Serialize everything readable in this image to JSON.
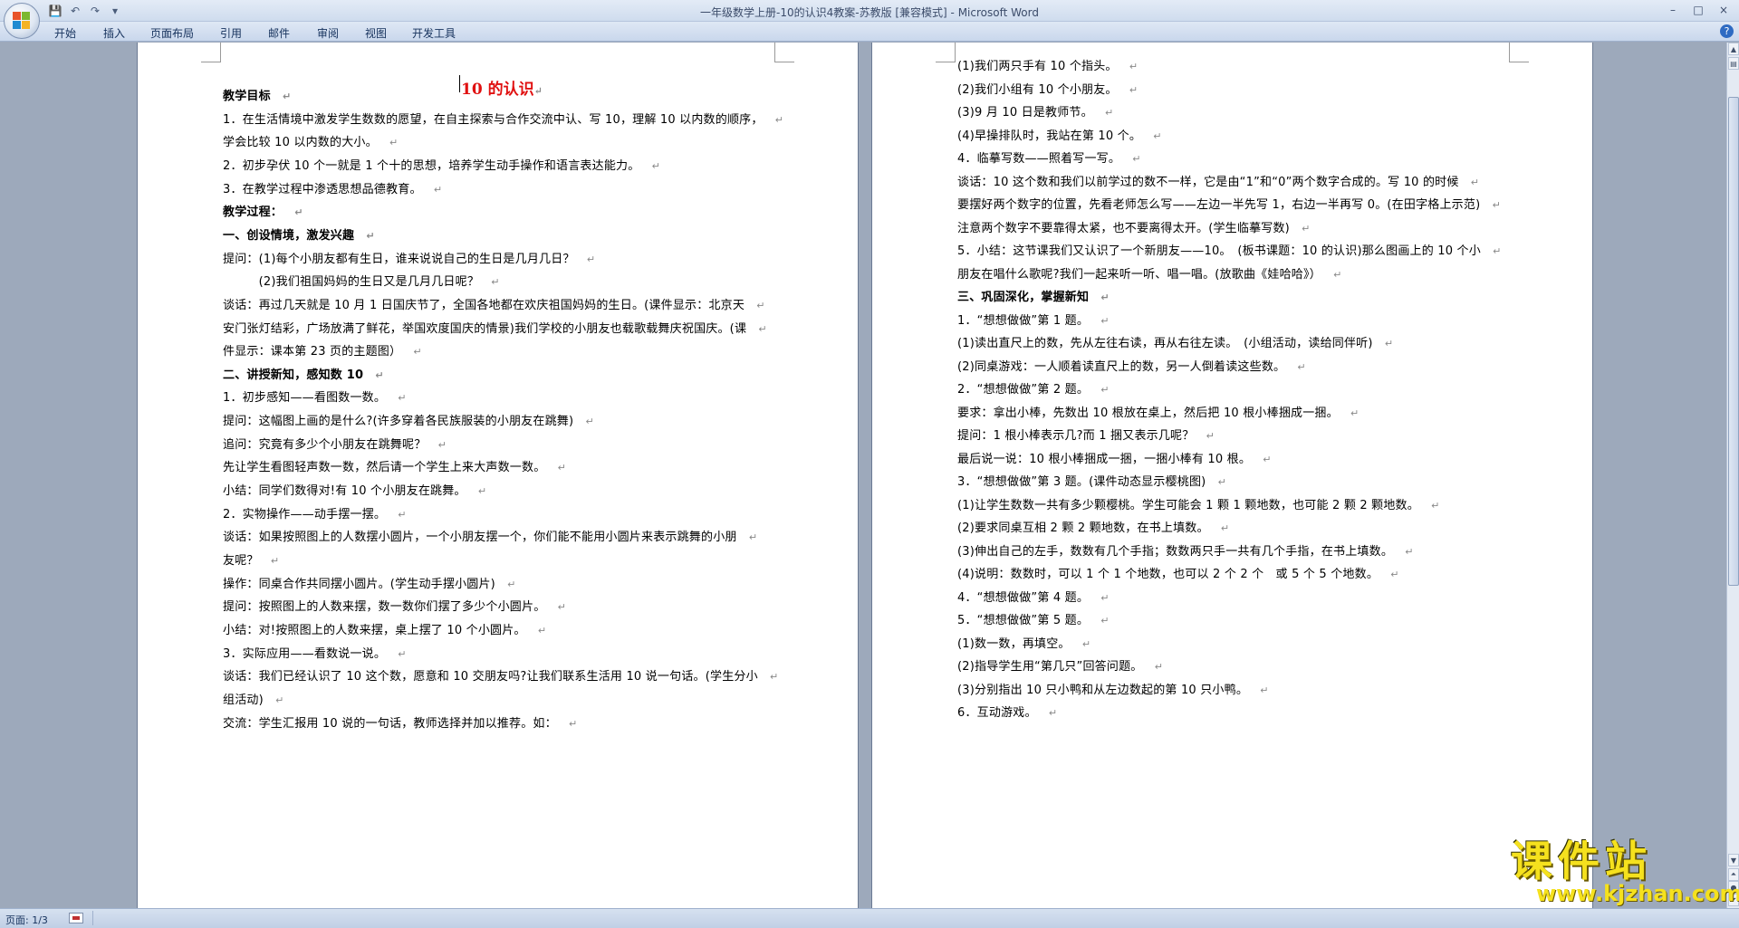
{
  "window": {
    "title": "一年级数学上册-10的认识4教案-苏教版 [兼容模式] - Microsoft Word",
    "controls": [
      "–",
      "□",
      "×"
    ]
  },
  "quick_access": {
    "save": "💾",
    "undo": "↶",
    "redo": "↷",
    "more": "▾"
  },
  "ribbon": {
    "tabs": [
      "开始",
      "插入",
      "页面布局",
      "引用",
      "邮件",
      "审阅",
      "视图",
      "开发工具"
    ],
    "help": "?"
  },
  "document": {
    "title": "10 的认识",
    "paragraph_mark": "↵",
    "page1_lines": [
      {
        "text": "教学目标",
        "bold": true
      },
      {
        "text": "1．在生活情境中激发学生数数的愿望，在自主探索与合作交流中认、写 10，理解 10 以内数的顺序，",
        "bold": false
      },
      {
        "text": "学会比较 10 以内数的大小。",
        "bold": false
      },
      {
        "text": "2．初步孕伏 10 个一就是 1 个十的思想，培养学生动手操作和语言表达能力。",
        "bold": false
      },
      {
        "text": "3．在教学过程中渗透思想品德教育。",
        "bold": false
      },
      {
        "text": "教学过程：",
        "bold": true
      },
      {
        "text": "一、创设情境，激发兴趣",
        "bold": true
      },
      {
        "text": "提问：(1)每个小朋友都有生日，谁来说说自己的生日是几月几日？",
        "bold": false
      },
      {
        "text": "　　　(2)我们祖国妈妈的生日又是几月几日呢？",
        "bold": false
      },
      {
        "text": "谈话：再过几天就是 10 月 1 日国庆节了，全国各地都在欢庆祖国妈妈的生日。(课件显示：北京天",
        "bold": false
      },
      {
        "text": "安门张灯结彩，广场放满了鲜花，举国欢度国庆的情景)我们学校的小朋友也载歌载舞庆祝国庆。(课",
        "bold": false
      },
      {
        "text": "件显示：课本第 23 页的主题图）",
        "bold": false
      },
      {
        "text": "二、讲授新知，感知数 10",
        "bold": true
      },
      {
        "text": "1．初步感知——看图数一数。",
        "bold": false
      },
      {
        "text": "提问：这幅图上画的是什么?(许多穿着各民族服装的小朋友在跳舞)",
        "bold": false
      },
      {
        "text": "追问：究竟有多少个小朋友在跳舞呢？",
        "bold": false
      },
      {
        "text": "先让学生看图轻声数一数，然后请一个学生上来大声数一数。",
        "bold": false
      },
      {
        "text": "小结：同学们数得对!有 10 个小朋友在跳舞。",
        "bold": false
      },
      {
        "text": "2．实物操作——动手摆一摆。",
        "bold": false
      },
      {
        "text": "谈话：如果按照图上的人数摆小圆片，一个小朋友摆一个，你们能不能用小圆片来表示跳舞的小朋",
        "bold": false
      },
      {
        "text": "友呢？",
        "bold": false
      },
      {
        "text": "操作：同桌合作共同摆小圆片。(学生动手摆小圆片)",
        "bold": false
      },
      {
        "text": "提问：按照图上的人数来摆，数一数你们摆了多少个小圆片。",
        "bold": false
      },
      {
        "text": "小结：对!按照图上的人数来摆，桌上摆了 10 个小圆片。",
        "bold": false
      },
      {
        "text": "3．实际应用——看数说一说。",
        "bold": false
      },
      {
        "text": "谈话：我们已经认识了 10 这个数，愿意和 10 交朋友吗?让我们联系生活用 10 说一句话。(学生分小",
        "bold": false
      },
      {
        "text": "组活动)",
        "bold": false
      },
      {
        "text": "交流：学生汇报用 10 说的一句话，教师选择并加以推荐。如：",
        "bold": false
      }
    ],
    "page2_lines": [
      {
        "text": "(1)我们两只手有 10 个指头。",
        "bold": false
      },
      {
        "text": "(2)我们小组有 10 个小朋友。",
        "bold": false
      },
      {
        "text": "(3)9 月 10 日是教师节。",
        "bold": false
      },
      {
        "text": "(4)早操排队时，我站在第 10 个。",
        "bold": false
      },
      {
        "text": "4．临摹写数——照着写一写。",
        "bold": false
      },
      {
        "text": "谈话：10 这个数和我们以前学过的数不一样，它是由“1”和“0”两个数字合成的。写 10 的时候",
        "bold": false
      },
      {
        "text": "要摆好两个数字的位置，先看老师怎么写——左边一半先写 1，右边一半再写 0。(在田字格上示范)",
        "bold": false
      },
      {
        "text": "注意两个数字不要靠得太紧，也不要离得太开。(学生临摹写数)",
        "bold": false
      },
      {
        "text": "5．小结：这节课我们又认识了一个新朋友——10。　(板书课题：10 的认识)那么图画上的 10 个小",
        "bold": false
      },
      {
        "text": "朋友在唱什么歌呢?我们一起来听一听、唱一唱。(放歌曲《娃哈哈》）",
        "bold": false
      },
      {
        "text": "三、巩固深化，掌握新知",
        "bold": true
      },
      {
        "text": "1．“想想做做”第 1 题。",
        "bold": false
      },
      {
        "text": "(1)读出直尺上的数，先从左往右读，再从右往左读。　(小组活动，读给同伴听)",
        "bold": false
      },
      {
        "text": "(2)同桌游戏：一人顺着读直尺上的数，另一人倒着读这些数。",
        "bold": false
      },
      {
        "text": "2．“想想做做”第 2 题。",
        "bold": false
      },
      {
        "text": "要求：拿出小棒，先数出 10 根放在桌上，然后把 10 根小棒捆成一捆。",
        "bold": false
      },
      {
        "text": "提问：1 根小棒表示几?而 1 捆又表示几呢？",
        "bold": false
      },
      {
        "text": "最后说一说：10 根小棒捆成一捆，一捆小棒有 10 根。",
        "bold": false
      },
      {
        "text": "3．“想想做做”第 3 题。(课件动态显示樱桃图)",
        "bold": false
      },
      {
        "text": "(1)让学生数数一共有多少颗樱桃。学生可能会 1 颗 1 颗地数，也可能 2 颗 2 颗地数。",
        "bold": false
      },
      {
        "text": "(2)要求同桌互相 2 颗 2 颗地数，在书上填数。",
        "bold": false
      },
      {
        "text": "(3)伸出自己的左手，数数有几个手指；数数两只手一共有几个手指，在书上填数。",
        "bold": false
      },
      {
        "text": "(4)说明：数数时，可以 1 个 1 个地数，也可以 2 个 2 个　或 5 个 5 个地数。",
        "bold": false
      },
      {
        "text": "4．“想想做做”第 4 题。",
        "bold": false
      },
      {
        "text": "5．“想想做做”第 5 题。",
        "bold": false
      },
      {
        "text": "(1)数一数，再填空。",
        "bold": false
      },
      {
        "text": "(2)指导学生用“第几只”回答问题。",
        "bold": false
      },
      {
        "text": "(3)分别指出 10 只小鸭和从左边数起的第 10 只小鸭。",
        "bold": false
      },
      {
        "text": "6．互动游戏。",
        "bold": false
      }
    ]
  },
  "statusbar": {
    "page": "页面: 1/3"
  },
  "watermark": {
    "main": "课件站",
    "url": "www.kjzhan.com"
  },
  "colors": {
    "title_red": "#e01010",
    "watermark_yellow": "#f5e11e",
    "workspace": "#9da9bb"
  }
}
